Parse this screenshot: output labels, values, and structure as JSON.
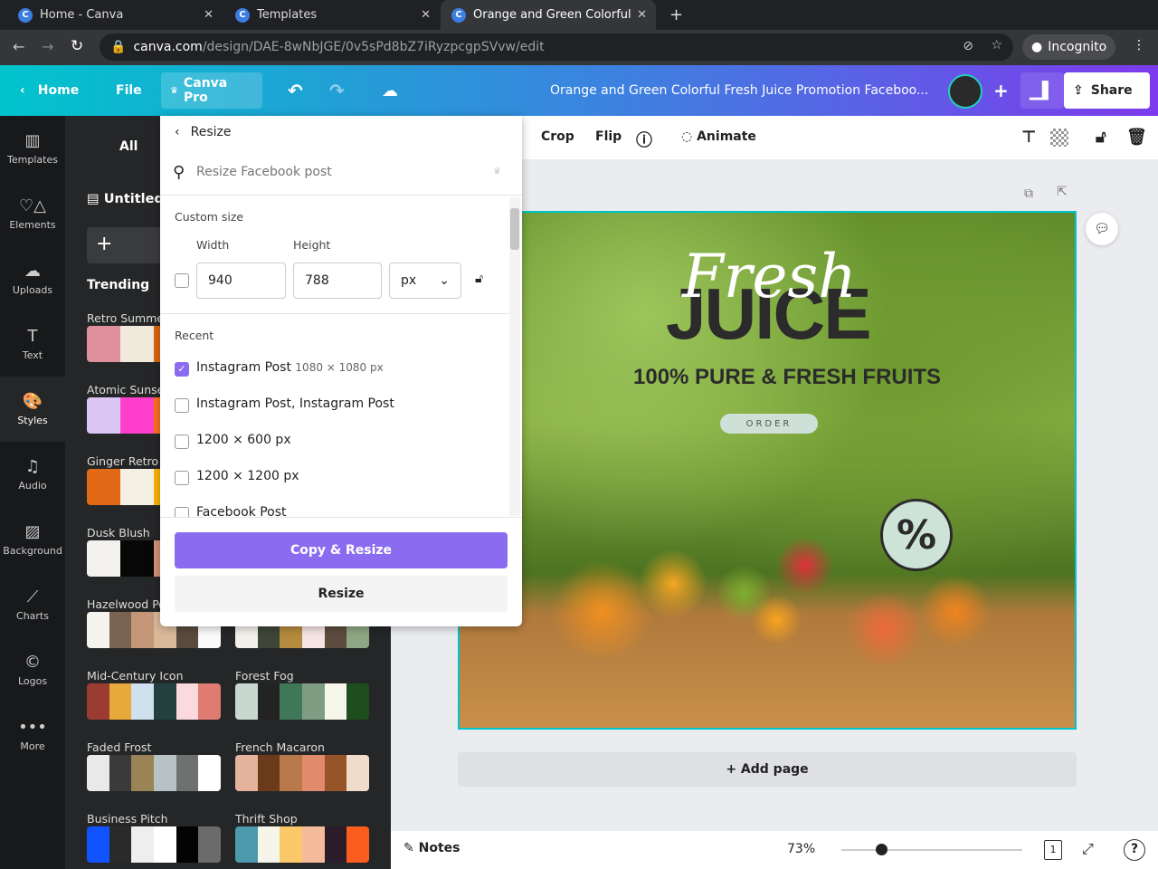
{
  "browser": {
    "tabs": [
      {
        "title": "Home - Canva"
      },
      {
        "title": "Templates"
      },
      {
        "title": "Orange and Green Colorful"
      }
    ],
    "url_host": "canva.com",
    "url_path": "/design/DAE-8wNbJGE/0v5sPd8bZ7iRyzpcgpSVvw/edit",
    "profile": "Incognito"
  },
  "header": {
    "home": "Home",
    "file": "File",
    "canva_pro": "Canva Pro",
    "title": "Orange and Green Colorful Fresh Juice Promotion Faceboo...",
    "share": "Share"
  },
  "rail": [
    {
      "label": "Templates",
      "icon": "▥"
    },
    {
      "label": "Elements",
      "icon": "♡△"
    },
    {
      "label": "Uploads",
      "icon": "☁"
    },
    {
      "label": "Text",
      "icon": "T"
    },
    {
      "label": "Styles",
      "icon": "🎨"
    },
    {
      "label": "Audio",
      "icon": "♫"
    },
    {
      "label": "Background",
      "icon": "▨"
    },
    {
      "label": "Charts",
      "icon": "⟋"
    },
    {
      "label": "Logos",
      "icon": "©"
    },
    {
      "label": "More",
      "icon": "•••"
    }
  ],
  "panel": {
    "tab_all": "All",
    "untitled": "Untitled",
    "trending": "Trending",
    "palettes_left": [
      {
        "name": "Retro Summer",
        "colors": [
          "#e0909c",
          "#efeadc",
          "#d9650f",
          "#c7861a"
        ]
      },
      {
        "name": "Atomic Sunset",
        "colors": [
          "#dcc6f5",
          "#ff3fcb",
          "#fc7120",
          "#2340c8"
        ]
      },
      {
        "name": "Ginger Retro",
        "colors": [
          "#e26a17",
          "#f4f1e4",
          "#fcb406",
          "#e0a000"
        ]
      },
      {
        "name": "Dusk Blush",
        "colors": [
          "#f2f1ee",
          "#070707",
          "#cf927a",
          "#3e3a38"
        ]
      },
      {
        "name": "Hazelwood Pop",
        "colors": [
          "#f5f3ee",
          "#7a6350",
          "#c49678",
          "#dab99a",
          "#5a4a3e",
          "#fafafa"
        ]
      },
      {
        "name": "Mid-Century Icon",
        "colors": [
          "#9b3c33",
          "#e6a93a",
          "#cfe0ee",
          "#23403f",
          "#fcd9dd",
          "#e07b72"
        ]
      },
      {
        "name": "Faded Frost",
        "colors": [
          "#e9e9e9",
          "#3a3a3a",
          "#9a8356",
          "#b6c2c4",
          "#6f7171",
          "#ffffff"
        ]
      },
      {
        "name": "Business Pitch",
        "colors": [
          "#1153fe",
          "#2a2a2a",
          "#eeeeee",
          "#ffffff",
          "#030303",
          "#6b6b6b"
        ]
      }
    ],
    "palettes_right": [
      {
        "name": "",
        "colors": [
          "#f3f0ea",
          "#3d4637",
          "#b48a3e",
          "#f5e4e4",
          "#5d4b3d",
          "#8ea683"
        ]
      },
      {
        "name": "Forest Fog",
        "colors": [
          "#c8d8d0",
          "#232323",
          "#3f7858",
          "#7f9d82",
          "#f6f6ea",
          "#1e4d1e"
        ]
      },
      {
        "name": "French Macaron",
        "colors": [
          "#e5b39b",
          "#6a3a1a",
          "#b7784a",
          "#e28a6c",
          "#975429",
          "#f0dccb"
        ]
      },
      {
        "name": "Thrift Shop",
        "colors": [
          "#4c9aac",
          "#f5f5ea",
          "#fcc96a",
          "#f4bb9b",
          "#2a1d29",
          "#fa5d1e"
        ]
      }
    ]
  },
  "resize": {
    "back": "Resize",
    "search_placeholder": "Resize Facebook post",
    "custom_size": "Custom size",
    "width_label": "Width",
    "height_label": "Height",
    "width": "940",
    "height": "788",
    "unit": "px",
    "recent": "Recent",
    "items": [
      {
        "label": "Instagram Post",
        "dims": "1080 × 1080 px",
        "checked": true
      },
      {
        "label": "Instagram Post, Instagram Post",
        "dims": "",
        "checked": false
      },
      {
        "label": "1200 × 600 px",
        "dims": "",
        "checked": false
      },
      {
        "label": "1200 × 1200 px",
        "dims": "",
        "checked": false
      },
      {
        "label": "Facebook Post",
        "dims": "",
        "checked": false
      }
    ],
    "copy_resize": "Copy & Resize",
    "resize_btn": "Resize",
    "accent": "#8b6cf0"
  },
  "toolbar": {
    "crop": "Crop",
    "flip": "Flip",
    "animate": "Animate"
  },
  "design": {
    "script": "Fresh",
    "headline": "JUICE",
    "sub": "100% PURE & FRESH FRUITS",
    "cta": "ORDER",
    "badge": "%"
  },
  "canvas": {
    "add_page": "+ Add page"
  },
  "bottom": {
    "notes": "Notes",
    "zoom": "73%",
    "zoom_level": 0.22,
    "page": "1"
  }
}
